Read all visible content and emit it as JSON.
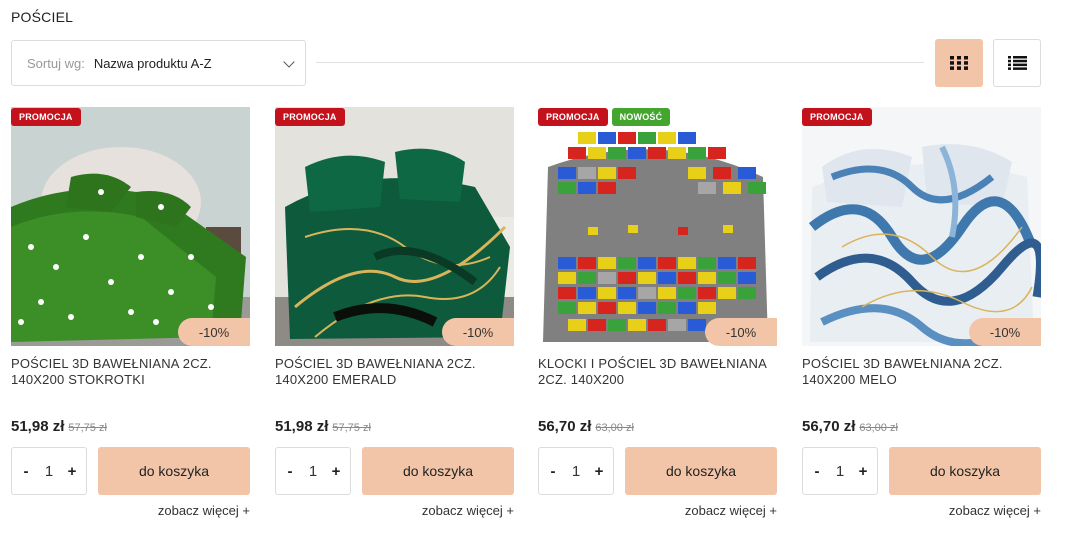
{
  "page": {
    "title": "POŚCIEL"
  },
  "sort": {
    "label": "Sortuj wg:",
    "value": "Nazwa produktu A-Z"
  },
  "view": {
    "active": "grid"
  },
  "colors": {
    "accent": "#f3c5a8",
    "promo": "#c4121c",
    "new": "#44a52f"
  },
  "products": [
    {
      "name": "POŚCIEL 3D BAWEŁNIANA 2cz. 140x200 STOKROTKI",
      "badges": [
        "PROMOCJA"
      ],
      "discount": "-10%",
      "price": "51,98 zł",
      "old_price": "57,75 zł",
      "qty": "1",
      "cart_label": "do koszyka",
      "more_label": "zobacz więcej +"
    },
    {
      "name": "POŚCIEL 3D BAWEŁNIANA 2cz. 140x200 EMERALD",
      "badges": [
        "PROMOCJA"
      ],
      "discount": "-10%",
      "price": "51,98 zł",
      "old_price": "57,75 zł",
      "qty": "1",
      "cart_label": "do koszyka",
      "more_label": "zobacz więcej +"
    },
    {
      "name": "KLOCKI I POŚCIEL 3D BAWEŁNIANA 2cz. 140x200",
      "badges": [
        "PROMOCJA",
        "NOWOŚĆ"
      ],
      "discount": "-10%",
      "price": "56,70 zł",
      "old_price": "63,00 zł",
      "qty": "1",
      "cart_label": "do koszyka",
      "more_label": "zobacz więcej +"
    },
    {
      "name": "POŚCIEL 3D BAWEŁNIANA 2cz. 140x200 MELO",
      "badges": [
        "PROMOCJA"
      ],
      "discount": "-10%",
      "price": "56,70 zł",
      "old_price": "63,00 zł",
      "qty": "1",
      "cart_label": "do koszyka",
      "more_label": "zobacz więcej +"
    }
  ]
}
